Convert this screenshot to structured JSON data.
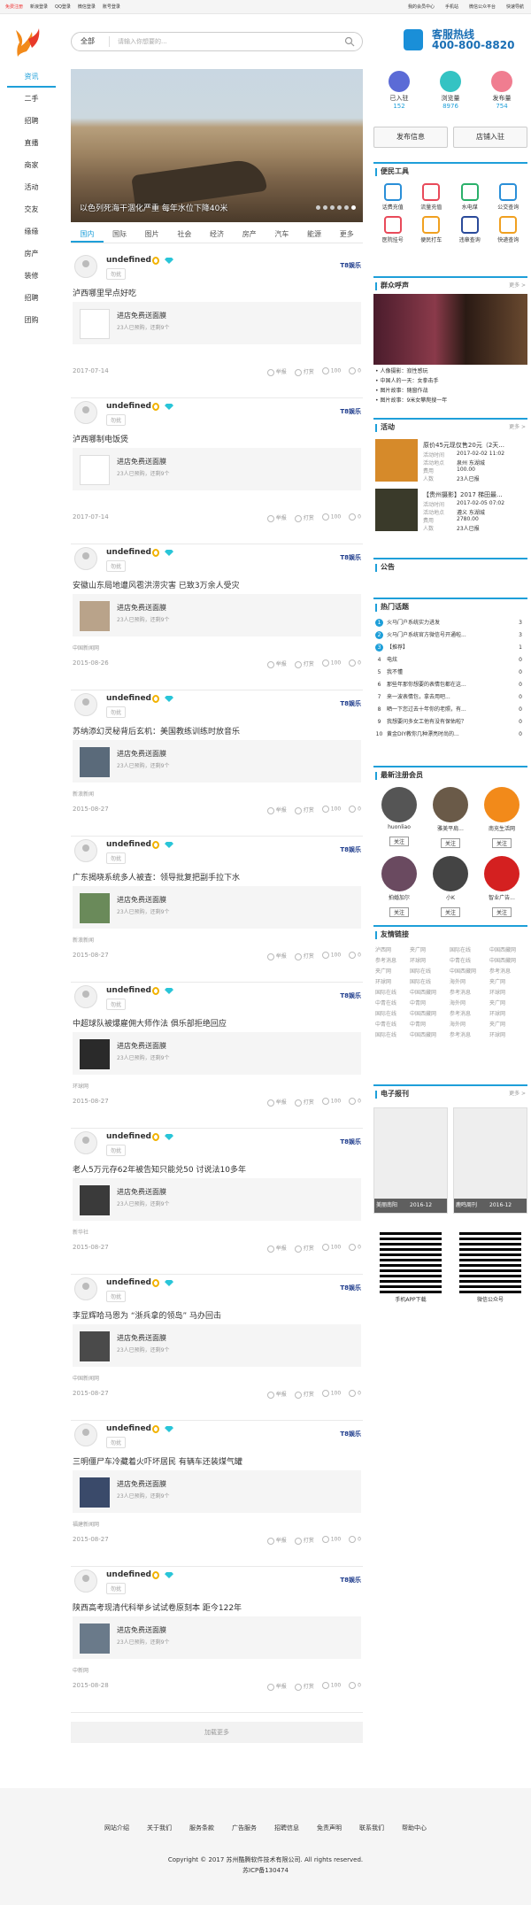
{
  "topbar": {
    "left": [
      "免费注册",
      "新浪登录",
      "QQ登录",
      "微信登录",
      "账号登录"
    ],
    "right": [
      "我的会员中心",
      "手机站",
      "微信公众平台",
      "快速导航"
    ]
  },
  "search": {
    "category": "全部",
    "placeholder": "请输入你想要的..."
  },
  "hotline": {
    "title": "客服热线",
    "number": "400-800-8820"
  },
  "nav": [
    "资讯",
    "二手",
    "招聘",
    "直播",
    "商家",
    "活动",
    "交友",
    "缘缘",
    "房产",
    "装修",
    "招聘",
    "团购"
  ],
  "hero": {
    "caption": "以色列死海干涸化严重 每年水位下降40米",
    "dots": 6
  },
  "tabs": [
    "国内",
    "国际",
    "图片",
    "社会",
    "经济",
    "房产",
    "汽车",
    "能源",
    "更多"
  ],
  "posts": [
    {
      "name": "undefined",
      "tag": "勿扰",
      "brand": "T8娱乐",
      "title": "泸西哪里早点好吃",
      "box_title": "进店免费送面膜",
      "box_sub": "23人已预购，还剩9个",
      "src": "",
      "date": "2017-07-14",
      "actions": [
        "举报",
        "打赏",
        "100",
        "0"
      ],
      "thumb": false
    },
    {
      "name": "undefined",
      "tag": "勿扰",
      "brand": "T8娱乐",
      "title": "泸西哪制电饭煲",
      "box_title": "进店免费送面膜",
      "box_sub": "23人已预购，还剩9个",
      "src": "",
      "date": "2017-07-14",
      "actions": [
        "举报",
        "打赏",
        "100",
        "0"
      ],
      "thumb": false
    },
    {
      "name": "undefined",
      "tag": "勿扰",
      "brand": "T8娱乐",
      "title": "安徽山东局地遭风雹洪涝灾害 已致3万余人受灾",
      "box_title": "进店免费送面膜",
      "box_sub": "23人已预购，还剩9个",
      "src": "中国新闻网",
      "date": "2015-08-26",
      "actions": [
        "举报",
        "打赏",
        "100",
        "0"
      ],
      "thumb": true
    },
    {
      "name": "undefined",
      "tag": "勿扰",
      "brand": "T8娱乐",
      "title": "苏纳添幻灵秘背后玄机：美国教练训练时放音乐",
      "box_title": "进店免费送面膜",
      "box_sub": "23人已预购，还剩9个",
      "src": "新浪新闻",
      "date": "2015-08-27",
      "actions": [
        "举报",
        "打赏",
        "100",
        "0"
      ],
      "thumb": true
    },
    {
      "name": "undefined",
      "tag": "勿扰",
      "brand": "T8娱乐",
      "title": "广东揭晓系统多人被查：领导批复把副手拉下水",
      "box_title": "进店免费送面膜",
      "box_sub": "23人已预购，还剩9个",
      "src": "新浪新闻",
      "date": "2015-08-27",
      "actions": [
        "举报",
        "打赏",
        "100",
        "0"
      ],
      "thumb": true
    },
    {
      "name": "undefined",
      "tag": "勿扰",
      "brand": "T8娱乐",
      "title": "中超球队被爆雇佣大师作法 俱乐部拒绝回应",
      "box_title": "进店免费送面膜",
      "box_sub": "23人已预购，还剩9个",
      "src": "环球网",
      "date": "2015-08-27",
      "actions": [
        "举报",
        "打赏",
        "100",
        "0"
      ],
      "thumb": true
    },
    {
      "name": "undefined",
      "tag": "勿扰",
      "brand": "T8娱乐",
      "title": "老人5万元存62年被告知只能兑50 讨说法10多年",
      "box_title": "进店免费送面膜",
      "box_sub": "23人已预购，还剩9个",
      "src": "新华社",
      "date": "2015-08-27",
      "actions": [
        "举报",
        "打赏",
        "100",
        "0"
      ],
      "thumb": true
    },
    {
      "name": "undefined",
      "tag": "勿扰",
      "brand": "T8娱乐",
      "title": "李显辉哈马恩为 “浙兵拿的领岛” 马办回击",
      "box_title": "进店免费送面膜",
      "box_sub": "23人已预购，还剩9个",
      "src": "中国新闻网",
      "date": "2015-08-27",
      "actions": [
        "举报",
        "打赏",
        "100",
        "0"
      ],
      "thumb": true
    },
    {
      "name": "undefined",
      "tag": "勿扰",
      "brand": "T8娱乐",
      "title": "三明僵尸车冷藏着火吓坏居民 有辆车还装煤气罐",
      "box_title": "进店免费送面膜",
      "box_sub": "23人已预购，还剩9个",
      "src": "福建新闻网",
      "date": "2015-08-27",
      "actions": [
        "举报",
        "打赏",
        "100",
        "0"
      ],
      "thumb": true
    },
    {
      "name": "undefined",
      "tag": "勿扰",
      "brand": "T8娱乐",
      "title": "陕西高考现清代科举乡试试卷原刻本 距今122年",
      "box_title": "进店免费送面膜",
      "box_sub": "23人已预购，还剩9个",
      "src": "中新网",
      "date": "2015-08-28",
      "actions": [
        "举报",
        "打赏",
        "100",
        "0"
      ],
      "thumb": true
    }
  ],
  "more": "加载更多",
  "stats": [
    {
      "label": "已入驻",
      "value": "152",
      "color": "#5b6bd6"
    },
    {
      "label": "浏览量",
      "value": "8976",
      "color": "#34c3c3"
    },
    {
      "label": "发布量",
      "value": "754",
      "color": "#f07d90"
    }
  ],
  "buttons": [
    "发布信息",
    "店铺入驻"
  ],
  "tools_title": "便民工具",
  "tools": [
    "话费充值",
    "流量充值",
    "水电煤",
    "公交查询",
    "医院挂号",
    "便民打车",
    "违章查询",
    "快递查询"
  ],
  "group_title": "群众呼声",
  "group_more": "更多 >",
  "group_list": [
    "• 人像摄影：寂性感玩",
    "• 中国人的一天：女拳击手",
    "• 图片故事：随窗作战",
    "• 图片故事：9米女攀爬搜一年"
  ],
  "activity_title": "活动",
  "activity_more": "更多 >",
  "activities": [
    {
      "title": "原价45元现仅售20元（2天...",
      "rows": [
        [
          "活动时间",
          "2017-02-02 11:02"
        ],
        [
          "活动地点",
          "泉州 东湖城"
        ],
        [
          "费用",
          "100.00"
        ],
        [
          "人数",
          "23人已报"
        ]
      ]
    },
    {
      "title": "【贵州摄影】2017 梯田最...",
      "rows": [
        [
          "活动时间",
          "2017-02-05 07:02"
        ],
        [
          "活动地点",
          "遵义 东湖城"
        ],
        [
          "费用",
          "2780.00"
        ],
        [
          "人数",
          "23人已报"
        ]
      ]
    }
  ],
  "notice_title": "公告",
  "hot_title": "热门话题",
  "hot": [
    {
      "n": "1",
      "t": "火马门户系统实力进发",
      "c": "3"
    },
    {
      "n": "2",
      "t": "火马门户系统官方微信号开通啦...",
      "c": "3"
    },
    {
      "n": "3",
      "t": "【推荐】",
      "c": "1"
    },
    {
      "n": "4",
      "t": "电炫",
      "c": "0"
    },
    {
      "n": "5",
      "t": "我不懂",
      "c": "0"
    },
    {
      "n": "6",
      "t": "那些年那你想要的表情包都在这...",
      "c": "0"
    },
    {
      "n": "7",
      "t": "来一波表情包，拿去用吧...",
      "c": "0"
    },
    {
      "n": "8",
      "t": "晒一下您过去十年你的老照，有...",
      "c": "0"
    },
    {
      "n": "9",
      "t": "我想要问多女工他有没有保佑啦？",
      "c": "0"
    },
    {
      "n": "10",
      "t": "黄金DIY教你几种漂亮时尚的...",
      "c": "0"
    }
  ],
  "members_title": "最新注册会员",
  "members": [
    {
      "name": "huonliao",
      "follow": "关注",
      "color": "#555"
    },
    {
      "name": "雅美平肩...",
      "follow": "关注",
      "color": "#6a5a48"
    },
    {
      "name": "南充生活网",
      "follow": "关注",
      "color": "#f28a1a"
    },
    {
      "name": "拍婚加尔",
      "follow": "关注",
      "color": "#6a4a60"
    },
    {
      "name": "小K",
      "follow": "关注",
      "color": "#444"
    },
    {
      "name": "智业广告...",
      "follow": "关注",
      "color": "#d42020"
    }
  ],
  "links_title": "友情链接",
  "links": [
    "泸西网",
    "夹广网",
    "国际在线",
    "中国西藏网",
    "参考消息",
    "环球网",
    "中青在线",
    "中国西藏网",
    "夹广网",
    "国际在线",
    "中国西藏网",
    "参考消息",
    "环球网",
    "国际在线",
    "海外网",
    "夹广网",
    "国际在线",
    "中国西藏网",
    "参考消息",
    "环球网",
    "中青在线",
    "中青网",
    "海外网",
    "夹广网",
    "国际在线",
    "中国西藏网",
    "参考消息",
    "环球网",
    "中青在线",
    "中青网",
    "海外网",
    "夹广网",
    "国际在线",
    "中国西藏网",
    "参考消息",
    "环球网"
  ],
  "papers_title": "电子报刊",
  "papers_more": "更多 >",
  "papers": [
    {
      "label": "美丽南阳",
      "date": "2016-12"
    },
    {
      "label": "鹿鸣周刊",
      "date": "2016-12"
    }
  ],
  "qrs": [
    "手机APP下载",
    "微信公众号"
  ],
  "footer": {
    "links": [
      "网站介绍",
      "关于我们",
      "服务条款",
      "广告服务",
      "招聘信息",
      "免责声明",
      "联系我们",
      "帮助中心"
    ],
    "copyright": "Copyright © 2017 苏州酷腾软件技术有限公司. All rights reserved.",
    "icp": "苏ICP备130474"
  }
}
